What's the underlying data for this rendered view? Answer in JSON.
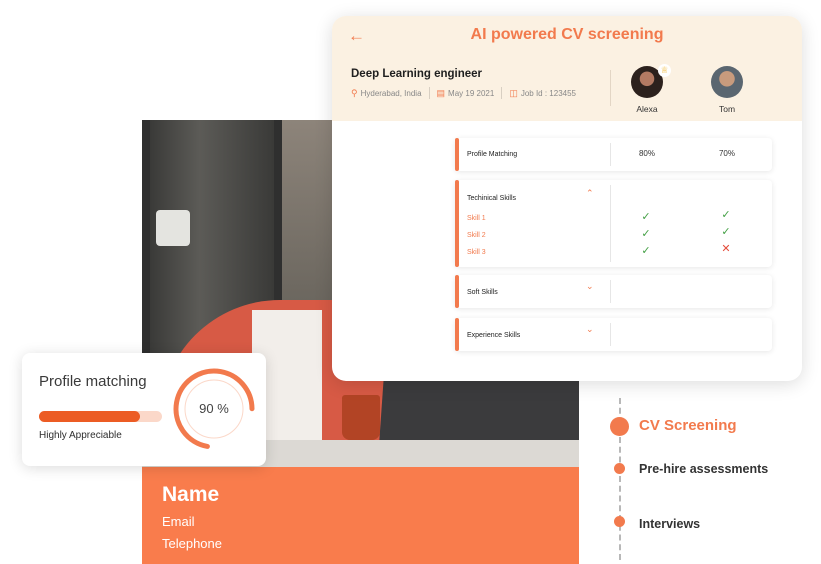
{
  "cv_panel": {
    "title": "AI powered CV screening",
    "job_title": "Deep Learning engineer",
    "location": "Hyderabad, India",
    "date": "May 19 2021",
    "job_id": "Job Id : 123455",
    "candidates": [
      {
        "name": "Alexa",
        "top_pick": true
      },
      {
        "name": "Tom",
        "top_pick": false
      }
    ],
    "sections": {
      "profile_matching": {
        "label": "Profile Matching",
        "values": [
          "80%",
          "70%"
        ]
      },
      "technical": {
        "label": "Techinical Skills",
        "expanded": true,
        "skills": [
          {
            "name": "Skill 1",
            "results": [
              true,
              true
            ]
          },
          {
            "name": "Skill 2",
            "results": [
              true,
              true
            ]
          },
          {
            "name": "Skill 3",
            "results": [
              true,
              false
            ]
          }
        ]
      },
      "soft": {
        "label": "Soft Skills",
        "expanded": false
      },
      "experience": {
        "label": "Experience Skills",
        "expanded": false
      }
    }
  },
  "profile_card": {
    "title": "Profile matching",
    "percent_label": "90 %",
    "percent": 90,
    "bar_fill_fraction": 0.82,
    "subtitle": "Highly Appreciable"
  },
  "name_card": {
    "name": "Name",
    "email": "Email",
    "telephone": "Telephone"
  },
  "steps": [
    {
      "label": "CV Screening",
      "active": true
    },
    {
      "label": "Pre-hire assessments",
      "active": false
    },
    {
      "label": "Interviews",
      "active": false
    }
  ],
  "colors": {
    "accent": "#f27a4d",
    "accent_dark": "#ec5c24",
    "panel_header_bg": "#fbf1e2",
    "check": "#45a046",
    "cross": "#e44c3b"
  }
}
